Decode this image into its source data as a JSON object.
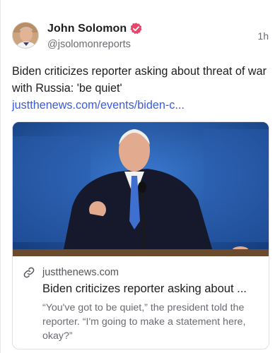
{
  "post": {
    "author": {
      "display_name": "John Solomon",
      "handle": "@jsolomonreports",
      "verified_icon": "verified-badge-icon",
      "avatar_icon": "avatar-photo"
    },
    "timestamp": "1h",
    "text": "Biden criticizes reporter asking about threat of war with Russia: 'be quiet' ",
    "link_text": "justthenews.com/events/biden-c...",
    "colors": {
      "link": "#3b5bdb",
      "verified_badge": "#e8456b"
    }
  },
  "link_card": {
    "image_description_icon": "article-photo",
    "domain_icon": "link-icon",
    "domain": "justthenews.com",
    "title": "Biden criticizes reporter asking about ...",
    "description": "“You've got to be quiet,” the president told the reporter. “I'm going to make a statement here, okay?”"
  }
}
